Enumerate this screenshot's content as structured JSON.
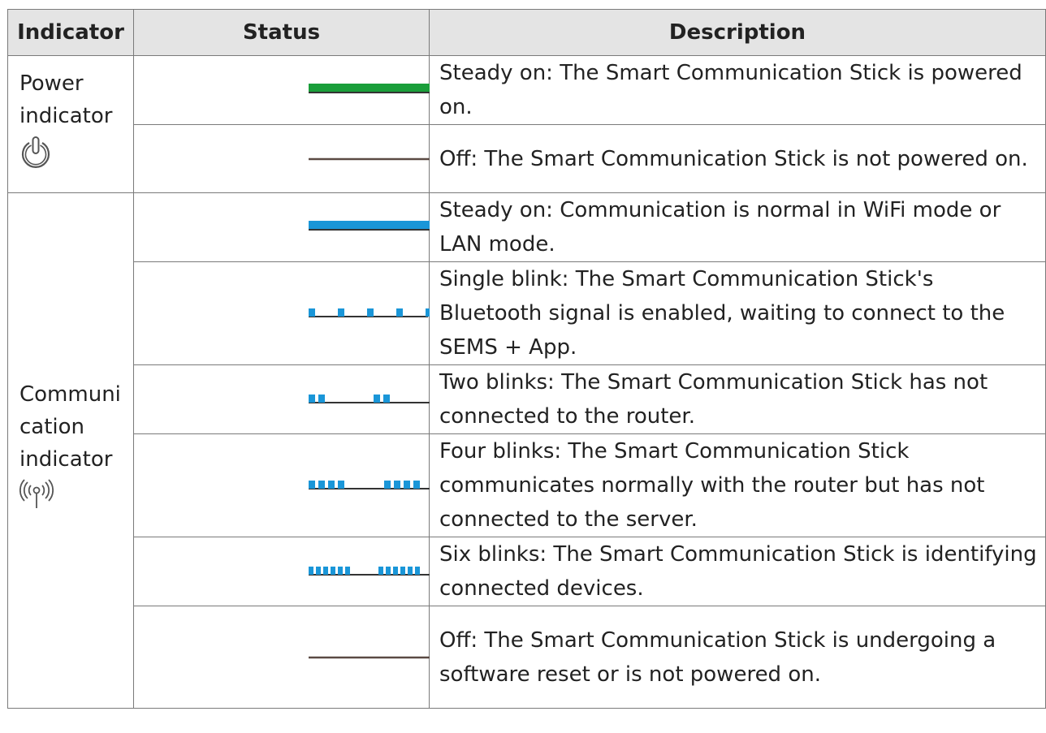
{
  "table": {
    "headers": {
      "indicator": "Indicator",
      "status": "Status",
      "description": "Description"
    },
    "indicators": {
      "power": {
        "label": "Power\nindicator",
        "icon": "power-icon"
      },
      "communication": {
        "label": "Communi\ncation\nindicator",
        "icon": "wireless-signal-icon"
      }
    },
    "rows": [
      {
        "pattern": "steady",
        "color": "#1a9e3a",
        "description": "Steady on: The Smart Communication Stick is powered on."
      },
      {
        "pattern": "off",
        "color": "#5a4a44",
        "description": "Off: The Smart Communication Stick is not powered on."
      },
      {
        "pattern": "steady",
        "color": "#1a96d8",
        "description": "Steady on: Communication is normal in WiFi mode or LAN mode."
      },
      {
        "pattern": "single-blink",
        "color": "#1a96d8",
        "description": "Single blink: The Smart Communication Stick's Bluetooth signal is enabled, waiting to connect to the SEMS + App."
      },
      {
        "pattern": "two-blinks",
        "color": "#1a96d8",
        "description": "Two blinks: The Smart Communication Stick has not connected to the router."
      },
      {
        "pattern": "four-blinks",
        "color": "#1a96d8",
        "description": "Four blinks: The Smart Communication Stick communicates normally with the router but has not connected to the server."
      },
      {
        "pattern": "six-blinks",
        "color": "#1a96d8",
        "description": "Six blinks: The Smart Communication Stick is identifying connected devices."
      },
      {
        "pattern": "off",
        "color": "#5a4a44",
        "description": "Off: The Smart Communication Stick is undergoing a software reset or is not powered on."
      }
    ]
  }
}
